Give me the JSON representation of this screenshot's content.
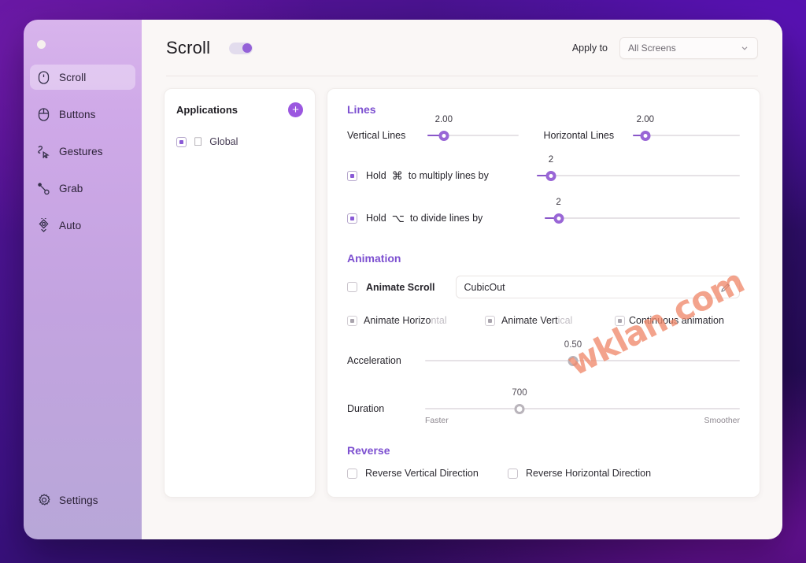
{
  "window": {
    "title": "Scroll",
    "enabled_toggle": true
  },
  "sidebar": {
    "items": [
      {
        "label": "Scroll",
        "icon": "mouse-scroll-icon",
        "active": true
      },
      {
        "label": "Buttons",
        "icon": "mouse-buttons-icon",
        "active": false
      },
      {
        "label": "Gestures",
        "icon": "gesture-cursor-icon",
        "active": false
      },
      {
        "label": "Grab",
        "icon": "grab-drag-icon",
        "active": false
      },
      {
        "label": "Auto",
        "icon": "auto-diamond-icon",
        "active": false
      }
    ],
    "settings": {
      "label": "Settings",
      "icon": "gear-icon"
    }
  },
  "header": {
    "apply_to_label": "Apply to",
    "screens_value": "All Screens",
    "chevron": "chevron-down-icon"
  },
  "apps_panel": {
    "title": "Applications",
    "add_label": "+",
    "items": [
      {
        "name": "Global",
        "icon": "apple-logo-icon",
        "checkbox": "mixed"
      }
    ]
  },
  "lines": {
    "section_title": "Lines",
    "vertical": {
      "label": "Vertical Lines",
      "value": "2.00",
      "percent": 18
    },
    "horizontal": {
      "label": "Horizontal Lines",
      "value": "2.00",
      "percent": 12
    },
    "multiply": {
      "label_pre": "Hold",
      "key": "⌘",
      "label_post": "to multiply lines by",
      "value": "2",
      "percent": 7,
      "checkbox": "mixed"
    },
    "divide": {
      "label_pre": "Hold",
      "key": "⌥",
      "label_post": "to divide lines by",
      "value": "2",
      "percent": 7,
      "checkbox": "mixed"
    }
  },
  "animation": {
    "section_title": "Animation",
    "animate_scroll": {
      "label": "Animate Scroll",
      "checkbox": "unchecked"
    },
    "easing": {
      "value": "CubicOut",
      "edit_icon": "pencil-icon"
    },
    "flags": [
      {
        "label": "Animate Horizontal",
        "visible_head": "Animate Horizo",
        "fade_tail": "ntal",
        "checkbox": "mixed-dim"
      },
      {
        "label": "Animate Vertical",
        "visible_head": "Animate Vert",
        "fade_tail": "ical",
        "checkbox": "mixed-dim"
      },
      {
        "label": "Continuous animation",
        "visible_head": "Continuous animation",
        "fade_tail": "",
        "checkbox": "mixed-dim"
      }
    ],
    "acceleration": {
      "label": "Acceleration",
      "value": "0.50",
      "percent": 47
    },
    "duration": {
      "label": "Duration",
      "value": "700",
      "percent": 30,
      "left_cap": "Faster",
      "right_cap": "Smoother"
    }
  },
  "reverse": {
    "section_title": "Reverse",
    "options": [
      {
        "label": "Reverse Vertical Direction",
        "checkbox": "unchecked"
      },
      {
        "label": "Reverse Horizontal Direction",
        "checkbox": "unchecked"
      }
    ]
  },
  "watermark": {
    "text": "wklan.com"
  },
  "colors": {
    "accent": "#7c4fd0",
    "slider": "#9966d6",
    "sidebar_top": "#d8b4ec",
    "watermark": "#f08a6c"
  }
}
